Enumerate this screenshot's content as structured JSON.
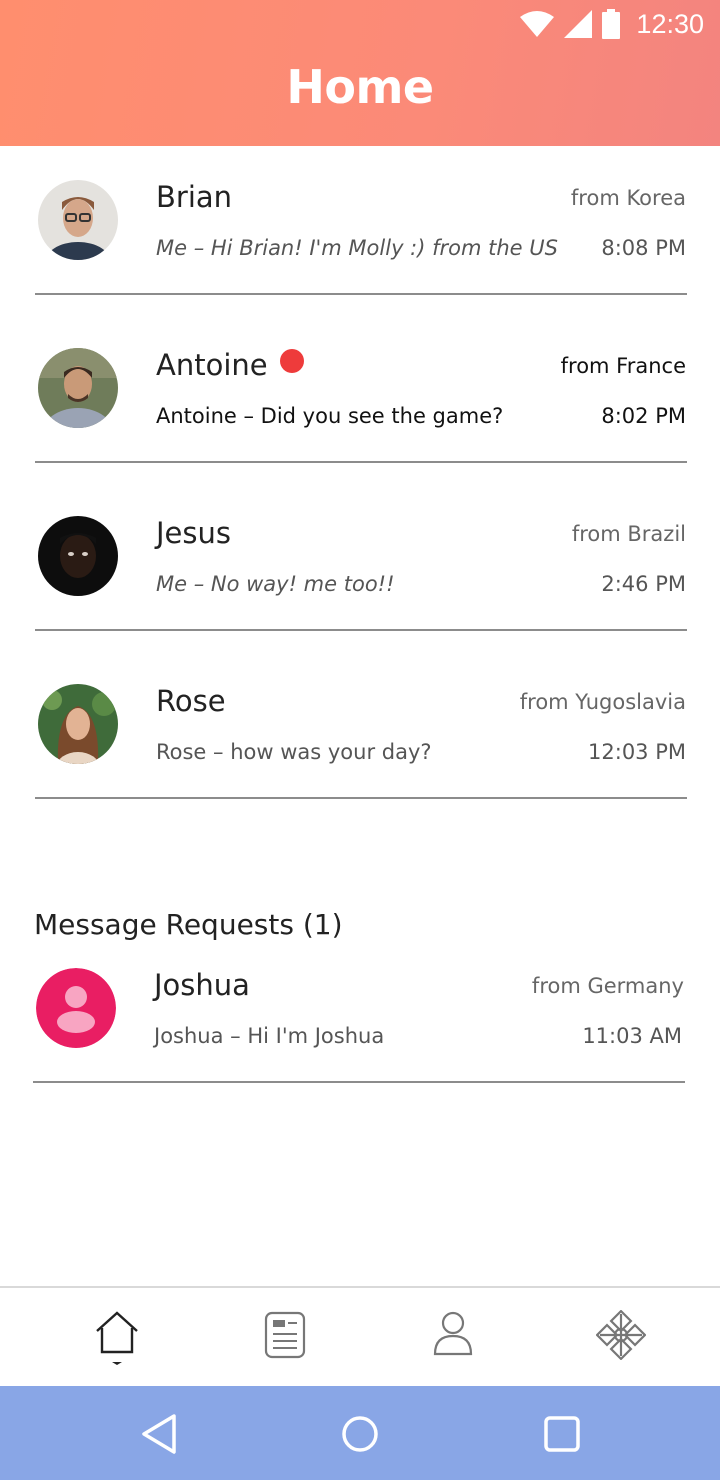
{
  "status_bar": {
    "time": "12:30",
    "icons": [
      "wifi-icon",
      "cell-signal-icon",
      "battery-icon"
    ]
  },
  "header": {
    "title": "Home"
  },
  "conversations": [
    {
      "name": "Brian",
      "origin": "from Korea",
      "preview": "Me – Hi Brian! I'm Molly :) from the US",
      "time": "8:08 PM",
      "unread": false,
      "italic": true
    },
    {
      "name": "Antoine",
      "origin": "from France",
      "preview": "Antoine – Did you see the game?",
      "time": "8:02 PM",
      "unread": true,
      "italic": false
    },
    {
      "name": "Jesus",
      "origin": "from Brazil",
      "preview": "Me – No way! me too!!",
      "time": "2:46 PM",
      "unread": false,
      "italic": true
    },
    {
      "name": "Rose",
      "origin": "from Yugoslavia",
      "preview": "Rose – how was your day?",
      "time": "12:03 PM",
      "unread": false,
      "italic": false
    }
  ],
  "requests": {
    "title": "Message Requests (1)",
    "items": [
      {
        "name": "Joshua",
        "origin": "from Germany",
        "preview": "Joshua – Hi I'm Joshua",
        "time": "11:03 AM"
      }
    ]
  },
  "bottom_nav": [
    {
      "id": "home",
      "icon": "home-icon",
      "active": true
    },
    {
      "id": "feed",
      "icon": "document-icon",
      "active": false
    },
    {
      "id": "profile",
      "icon": "user-icon",
      "active": false
    },
    {
      "id": "settings",
      "icon": "snowflake-icon",
      "active": false
    }
  ],
  "system_nav": [
    "back-icon",
    "home-circle-icon",
    "recents-icon"
  ],
  "colors": {
    "header_gradient_start": "#ff8e6e",
    "header_gradient_end": "#f3847f",
    "unread_dot": "#ee3b3b",
    "request_avatar": "#e91e63",
    "system_bar": "#89a6e6"
  }
}
